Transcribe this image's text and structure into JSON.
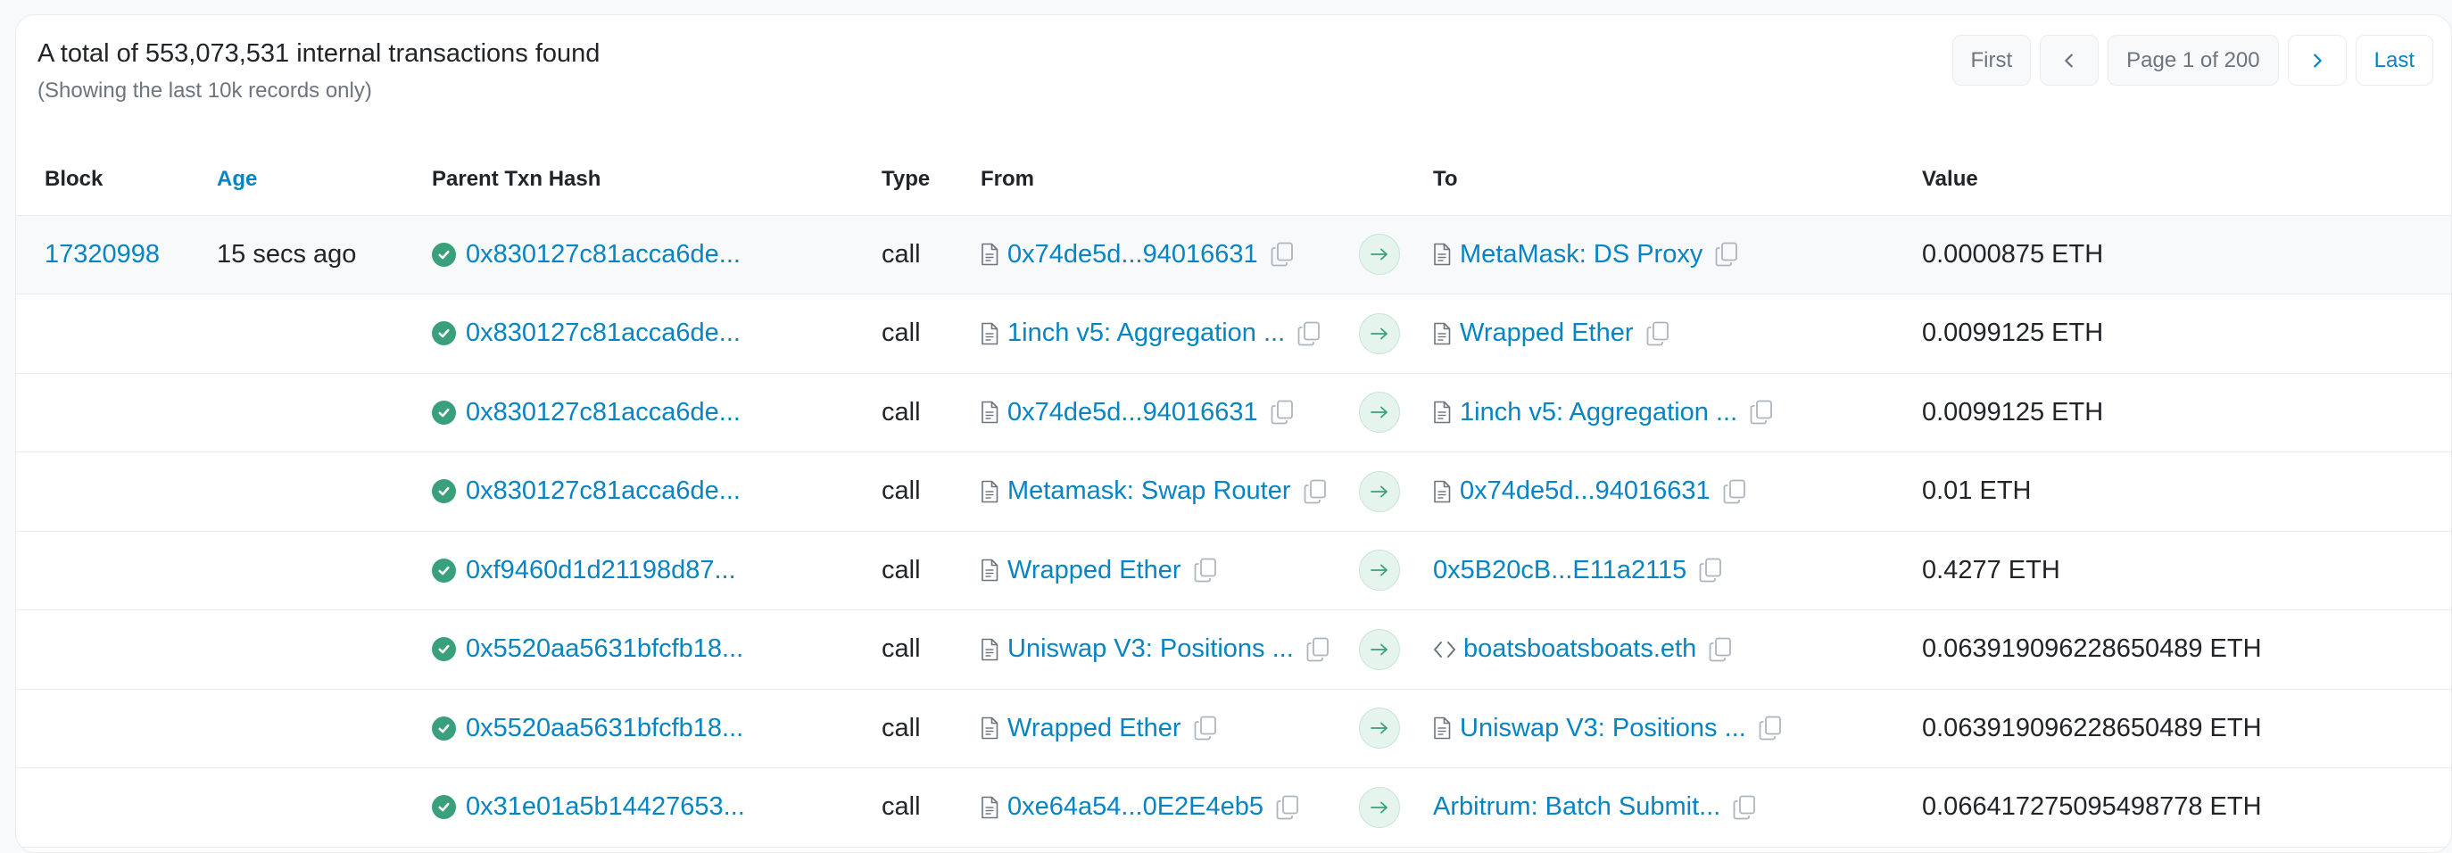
{
  "summary": {
    "total_text": "A total of 553,073,531 internal transactions found",
    "note": "(Showing the last 10k records only)"
  },
  "pagination": {
    "first_label": "First",
    "page_text": "Page 1 of 200",
    "last_label": "Last"
  },
  "columns": {
    "block": "Block",
    "age": "Age",
    "parent_hash": "Parent Txn Hash",
    "type": "Type",
    "from": "From",
    "to": "To",
    "value": "Value"
  },
  "rows": [
    {
      "block": "17320998",
      "age": "15 secs ago",
      "hash": "0x830127c81acca6de...",
      "type": "call",
      "from": "0x74de5d...94016631",
      "from_kind": "contract",
      "to": "MetaMask: DS Proxy",
      "to_kind": "contract",
      "value": "0.0000875 ETH",
      "highlight": true
    },
    {
      "block": "",
      "age": "",
      "hash": "0x830127c81acca6de...",
      "type": "call",
      "from": "1inch v5: Aggregation ...",
      "from_kind": "contract",
      "to": "Wrapped Ether",
      "to_kind": "contract",
      "value": "0.0099125 ETH",
      "highlight": false
    },
    {
      "block": "",
      "age": "",
      "hash": "0x830127c81acca6de...",
      "type": "call",
      "from": "0x74de5d...94016631",
      "from_kind": "contract",
      "to": "1inch v5: Aggregation ...",
      "to_kind": "contract",
      "value": "0.0099125 ETH",
      "highlight": false
    },
    {
      "block": "",
      "age": "",
      "hash": "0x830127c81acca6de...",
      "type": "call",
      "from": "Metamask: Swap Router",
      "from_kind": "contract",
      "to": "0x74de5d...94016631",
      "to_kind": "contract",
      "value": "0.01 ETH",
      "highlight": false
    },
    {
      "block": "",
      "age": "",
      "hash": "0xf9460d1d21198d87...",
      "type": "call",
      "from": "Wrapped Ether",
      "from_kind": "contract",
      "to": "0x5B20cB...E11a2115",
      "to_kind": "none",
      "value": "0.4277 ETH",
      "highlight": false
    },
    {
      "block": "",
      "age": "",
      "hash": "0x5520aa5631bfcfb18...",
      "type": "call",
      "from": "Uniswap V3: Positions ...",
      "from_kind": "contract",
      "to": "boatsboatsboats.eth",
      "to_kind": "code",
      "value": "0.063919096228650489 ETH",
      "highlight": false
    },
    {
      "block": "",
      "age": "",
      "hash": "0x5520aa5631bfcfb18...",
      "type": "call",
      "from": "Wrapped Ether",
      "from_kind": "contract",
      "to": "Uniswap V3: Positions ...",
      "to_kind": "contract",
      "value": "0.063919096228650489 ETH",
      "highlight": false
    },
    {
      "block": "",
      "age": "",
      "hash": "0x31e01a5b14427653...",
      "type": "call",
      "from": "0xe64a54...0E2E4eb5",
      "from_kind": "contract",
      "to": "Arbitrum: Batch Submit...",
      "to_kind": "none",
      "value": "0.066417275095498778 ETH",
      "highlight": false
    }
  ],
  "colors": {
    "link": "#0784c3",
    "success": "#3a9f7b",
    "border": "#e9ecef"
  },
  "icons": {
    "status": "check-circle-icon",
    "contract": "document-icon",
    "code": "code-icon",
    "copy": "copy-icon",
    "direction": "arrow-right-icon",
    "prev": "chevron-left-icon",
    "next": "chevron-right-icon"
  }
}
